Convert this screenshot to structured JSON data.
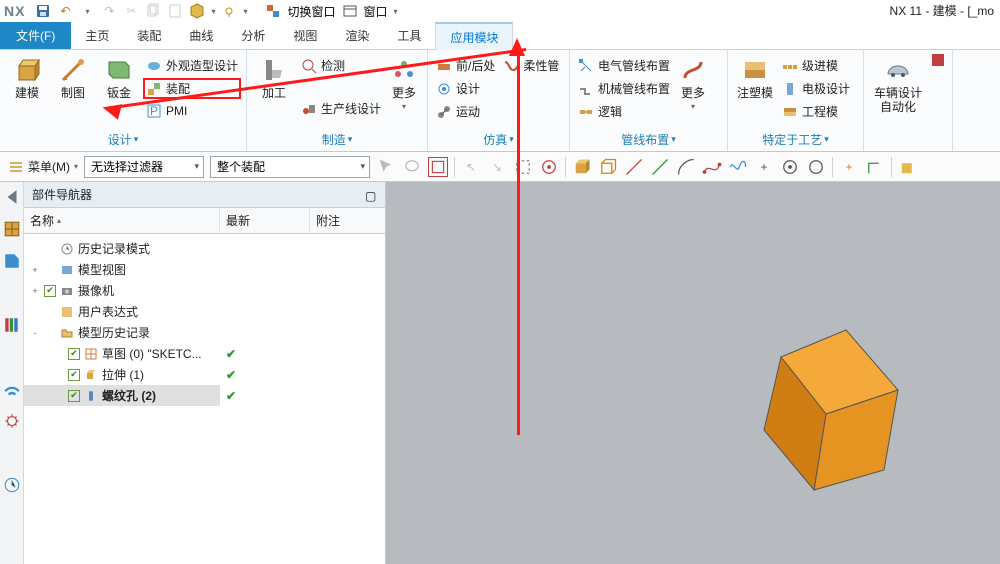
{
  "app": {
    "logo": "NX",
    "title": "NX 11 - 建模 - [_mo"
  },
  "qat": {
    "switch_window": "切换窗口",
    "window": "窗口"
  },
  "tabs": {
    "file": "文件(F)",
    "items": [
      "主页",
      "装配",
      "曲线",
      "分析",
      "视图",
      "渲染",
      "工具",
      "应用模块"
    ],
    "active_index": 7
  },
  "ribbon": {
    "g1": {
      "label": "设计",
      "big": [
        {
          "label": "建模"
        },
        {
          "label": "制图"
        },
        {
          "label": "钣金"
        }
      ],
      "stack": [
        {
          "label": "外观造型设计"
        },
        {
          "label": "装配",
          "highlight": true
        },
        {
          "label": "PMI"
        }
      ]
    },
    "g2": {
      "label": "制造",
      "big": [
        {
          "label": "加工"
        }
      ],
      "stack": [
        {
          "label": "检测"
        },
        {
          "label": "生产线设计"
        }
      ],
      "more": "更多"
    },
    "g3": {
      "label": "仿真",
      "stack": [
        {
          "label": "前/后处"
        },
        {
          "label": "设计"
        },
        {
          "label": "运动"
        }
      ],
      "extra": "柔性管"
    },
    "g4": {
      "label": "管线布置",
      "stack": [
        {
          "label": "电气管线布置"
        },
        {
          "label": "机械管线布置"
        },
        {
          "label": "逻辑"
        }
      ],
      "more": "更多"
    },
    "g5": {
      "label": "特定于工艺",
      "big": [
        {
          "label": "注塑模"
        }
      ],
      "stack": [
        {
          "label": "级进模"
        },
        {
          "label": "电极设计"
        },
        {
          "label": "工程模"
        }
      ]
    },
    "g6": {
      "label": "",
      "big": [
        {
          "label": "车辆设计\n自动化"
        }
      ]
    }
  },
  "selrow": {
    "menu": "菜单(M)",
    "filter": "无选择过滤器",
    "scope": "整个装配"
  },
  "nav": {
    "title": "部件导航器",
    "cols": {
      "name": "名称",
      "new": "最新",
      "note": "附注"
    },
    "nodes": [
      {
        "indent": 0,
        "twist": "",
        "chk": false,
        "icon": "clock",
        "label": "历史记录模式",
        "tick": false
      },
      {
        "indent": 0,
        "twist": "+",
        "chk": false,
        "icon": "modelview",
        "label": "模型视图",
        "tick": false
      },
      {
        "indent": 0,
        "twist": "+",
        "chk": true,
        "icon": "camera",
        "label": "摄像机",
        "tick": false
      },
      {
        "indent": 0,
        "twist": "",
        "chk": false,
        "icon": "expr",
        "label": "用户表达式",
        "tick": false
      },
      {
        "indent": 0,
        "twist": "-",
        "chk": false,
        "icon": "folder",
        "label": "模型历史记录",
        "tick": false
      },
      {
        "indent": 1,
        "twist": "",
        "chk": true,
        "icon": "sketch",
        "label": "草图 (0) \"SKETC...",
        "tick": true
      },
      {
        "indent": 1,
        "twist": "",
        "chk": true,
        "icon": "extrude",
        "label": "拉伸 (1)",
        "tick": true
      },
      {
        "indent": 1,
        "twist": "",
        "chk": true,
        "icon": "thread",
        "label": "螺纹孔 (2)",
        "tick": true,
        "bold": true,
        "sel": true
      }
    ]
  }
}
